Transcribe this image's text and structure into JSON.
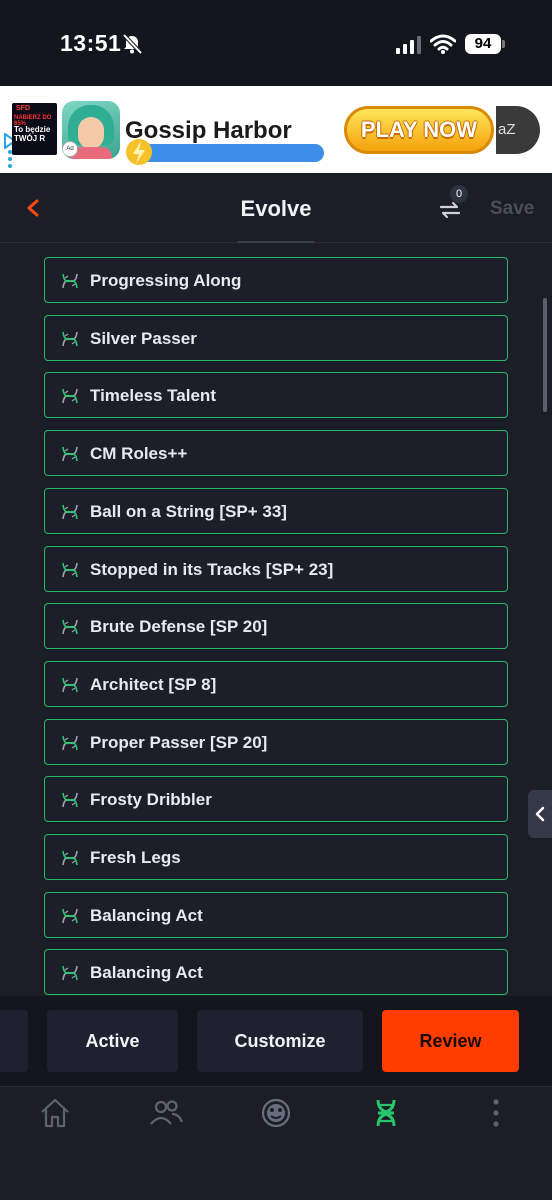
{
  "status_bar": {
    "time": "13:51",
    "battery": "94"
  },
  "ad": {
    "thumb_line1": "SFD",
    "thumb_line2": "NABIERZ DO 65%",
    "thumb_line3": "To będzie TWÓJ R",
    "badge": "Ad",
    "title": "Gossip Harbor",
    "cta": "PLAY NOW",
    "close_fragment": "aZ"
  },
  "header": {
    "title": "Evolve",
    "compare_count": "0",
    "save_label": "Save"
  },
  "evolutions": [
    "Progressing Along",
    "Silver Passer",
    "Timeless Talent",
    "CM Roles++",
    "Ball on a String [SP+ 33]",
    "Stopped in its Tracks [SP+ 23]",
    "Brute Defense [SP 20]",
    "Architect [SP 8]",
    "Proper Passer [SP 20]",
    "Frosty Dribbler",
    "Fresh Legs",
    "Balancing Act",
    "Balancing Act"
  ],
  "actions": {
    "active": "Active",
    "customize": "Customize",
    "review": "Review"
  },
  "bottom_nav": {
    "items": [
      "home-icon",
      "squad-icon",
      "club-icon",
      "evolutions-icon",
      "more-icon"
    ],
    "active_item": "evolutions-icon"
  },
  "colors": {
    "accent": "#ff3d00",
    "item_border": "#26b665",
    "background": "#1b1d27"
  }
}
